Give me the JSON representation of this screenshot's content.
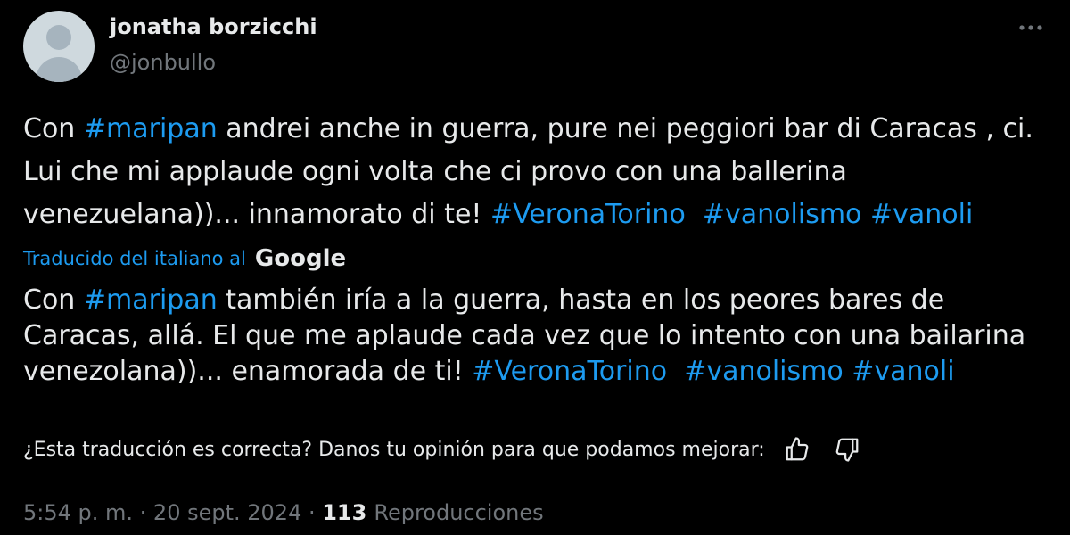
{
  "author": {
    "name": "jonatha borzicchi",
    "handle": "@jonbullo"
  },
  "more_icon": "more-horizontal-icon",
  "original_text": {
    "p1": "Con ",
    "h1": "#maripan",
    "p2": " andrei anche in guerra, pure nei peggiori bar di Caracas , ci. Lui che mi applaude ogni volta che ci provo con una ballerina venezuelana))... innamorato di te! ",
    "h2": "#VeronaTorino",
    "h3": "#vanolismo",
    "h4": "#vanoli"
  },
  "translation_label": "Traducido del italiano al",
  "translation_provider": "Google",
  "translated_text": {
    "p1": "Con ",
    "h1": "#maripan",
    "p2": " también iría a la guerra, hasta en los peores bares de Caracas, allá. El que me aplaude cada vez que lo intento con una bailarina venezolana))... enamorada de ti! ",
    "h2": "#VeronaTorino",
    "h3": "#vanolismo",
    "h4": "#vanoli"
  },
  "feedback": {
    "question": "¿Esta traducción es correcta? Danos tu opinión para que podamos mejorar:",
    "like_icon": "thumbs-up-icon",
    "dislike_icon": "thumbs-down-icon"
  },
  "meta": {
    "time": "5:54 p. m.",
    "date": "20 sept. 2024",
    "views_count": "113",
    "views_label": "Reproducciones"
  },
  "colors": {
    "background": "#000000",
    "text": "#e7e9ea",
    "muted": "#71767b",
    "link": "#1d9bf0"
  }
}
